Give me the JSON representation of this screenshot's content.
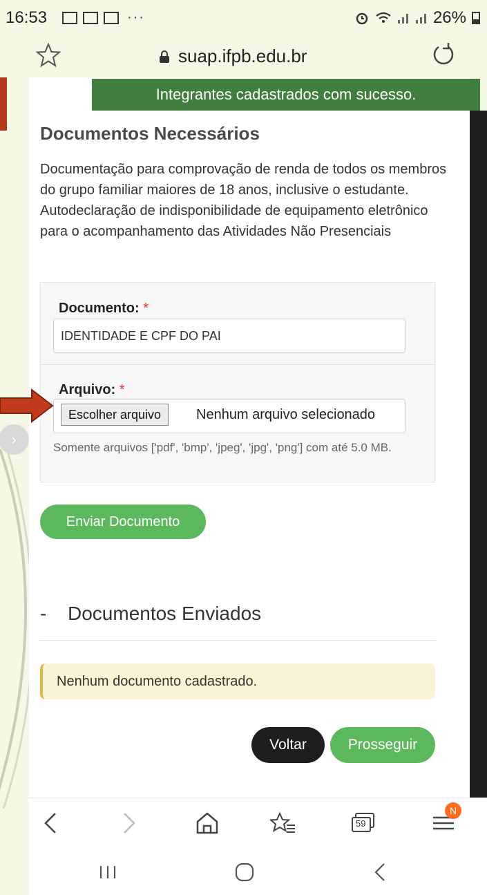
{
  "status_bar": {
    "time": "16:53",
    "more": "···",
    "battery_percent": "26%"
  },
  "browser": {
    "url": "suap.ifpb.edu.br"
  },
  "toast": "Integrantes cadastrados com sucesso.",
  "documents": {
    "title": "Documentos Necessários",
    "description_line1": "Documentação para comprovação de renda de todos os membros do grupo familiar maiores de 18 anos, inclusive o estudante.",
    "description_line2": "Autodeclaração de indisponibilidade de equipamento eletrônico para o acompanhamento das Atividades Não Presenciais"
  },
  "form": {
    "document_label": "Documento:",
    "document_value": "IDENTIDADE E CPF DO PAI",
    "file_label": "Arquivo:",
    "required_mark": "*",
    "file_button": "Escolher arquivo",
    "file_status": "Nenhum arquivo selecionado",
    "help_text": "Somente arquivos ['pdf', 'bmp', 'jpeg', 'jpg', 'png'] com até 5.0 MB.",
    "submit": "Enviar Documento"
  },
  "sent": {
    "dash": "-",
    "title": "Documentos Enviados",
    "empty_message": "Nenhum documento cadastrado."
  },
  "actions": {
    "back": "Voltar",
    "next": "Prosseguir"
  },
  "toolbar": {
    "tabs_count": "59",
    "menu_badge": "N"
  },
  "colors": {
    "success_green": "#5cb85c",
    "toast_green": "#3f7e3d",
    "annotation_red": "#c23b1b"
  }
}
